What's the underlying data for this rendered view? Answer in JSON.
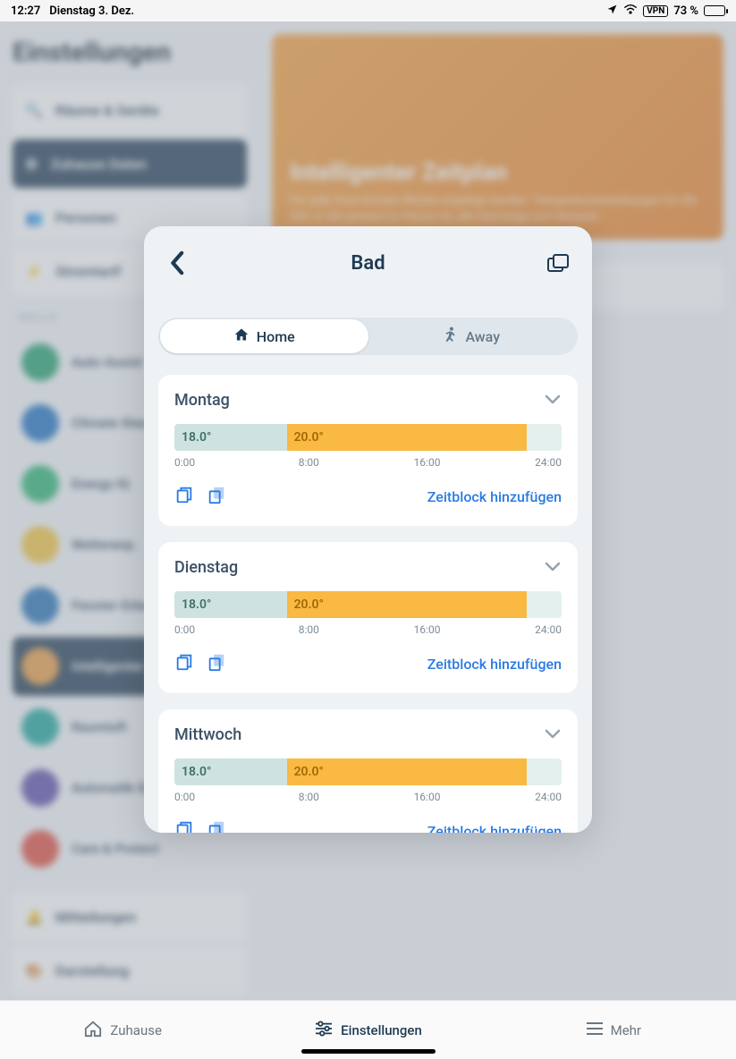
{
  "status": {
    "time": "12:27",
    "date": "Dienstag 3. Dez.",
    "battery": "73 %",
    "vpn": "VPN"
  },
  "bg": {
    "heading": "Einstellungen",
    "items": [
      "Räume & Geräte",
      "Zuhause Daten",
      "Personen",
      "Stromtarif"
    ],
    "sub": "SKILLS",
    "skills": [
      "Auto-Assist",
      "Climate Steuerung",
      "Energy IQ",
      "Wetteranp.",
      "Fenster-Erkennung",
      "Intelligenter Zeitplan",
      "Raumluft",
      "Automatik-Einstellung",
      "Care & Protect"
    ],
    "more": [
      "Mitteilungen",
      "Darstellung"
    ],
    "banner_title": "Intelligenter Zeitplan",
    "banner_text": "Für jede Zone können Blöcke angelegt werden. Temperatureinstellungen für die Zeit, in der jemand zu Hause ist, alle Dienstage zum Beispiel."
  },
  "modal": {
    "title": "Bad",
    "seg": {
      "home": "Home",
      "away": "Away"
    },
    "axis": [
      "0:00",
      "8:00",
      "16:00",
      "24:00"
    ],
    "add_label": "Zeitblock hinzufügen",
    "days": [
      {
        "name": "Montag",
        "blocks": [
          {
            "temp": "18.0°",
            "w": 29,
            "c": "cool"
          },
          {
            "temp": "20.0°",
            "w": 62,
            "c": "warm"
          },
          {
            "temp": "",
            "w": 9,
            "c": "tail"
          }
        ]
      },
      {
        "name": "Dienstag",
        "blocks": [
          {
            "temp": "18.0°",
            "w": 29,
            "c": "cool"
          },
          {
            "temp": "20.0°",
            "w": 62,
            "c": "warm"
          },
          {
            "temp": "",
            "w": 9,
            "c": "tail"
          }
        ]
      },
      {
        "name": "Mittwoch",
        "blocks": [
          {
            "temp": "18.0°",
            "w": 29,
            "c": "cool"
          },
          {
            "temp": "20.0°",
            "w": 62,
            "c": "warm"
          },
          {
            "temp": "",
            "w": 9,
            "c": "tail"
          }
        ]
      }
    ]
  },
  "tabs": {
    "home": "Zuhause",
    "settings": "Einstellungen",
    "more": "Mehr"
  },
  "colors": {
    "dark": "#1f3a52",
    "accent": "#2a7be4",
    "warm": "#f9b942",
    "cool": "#cee3df"
  }
}
